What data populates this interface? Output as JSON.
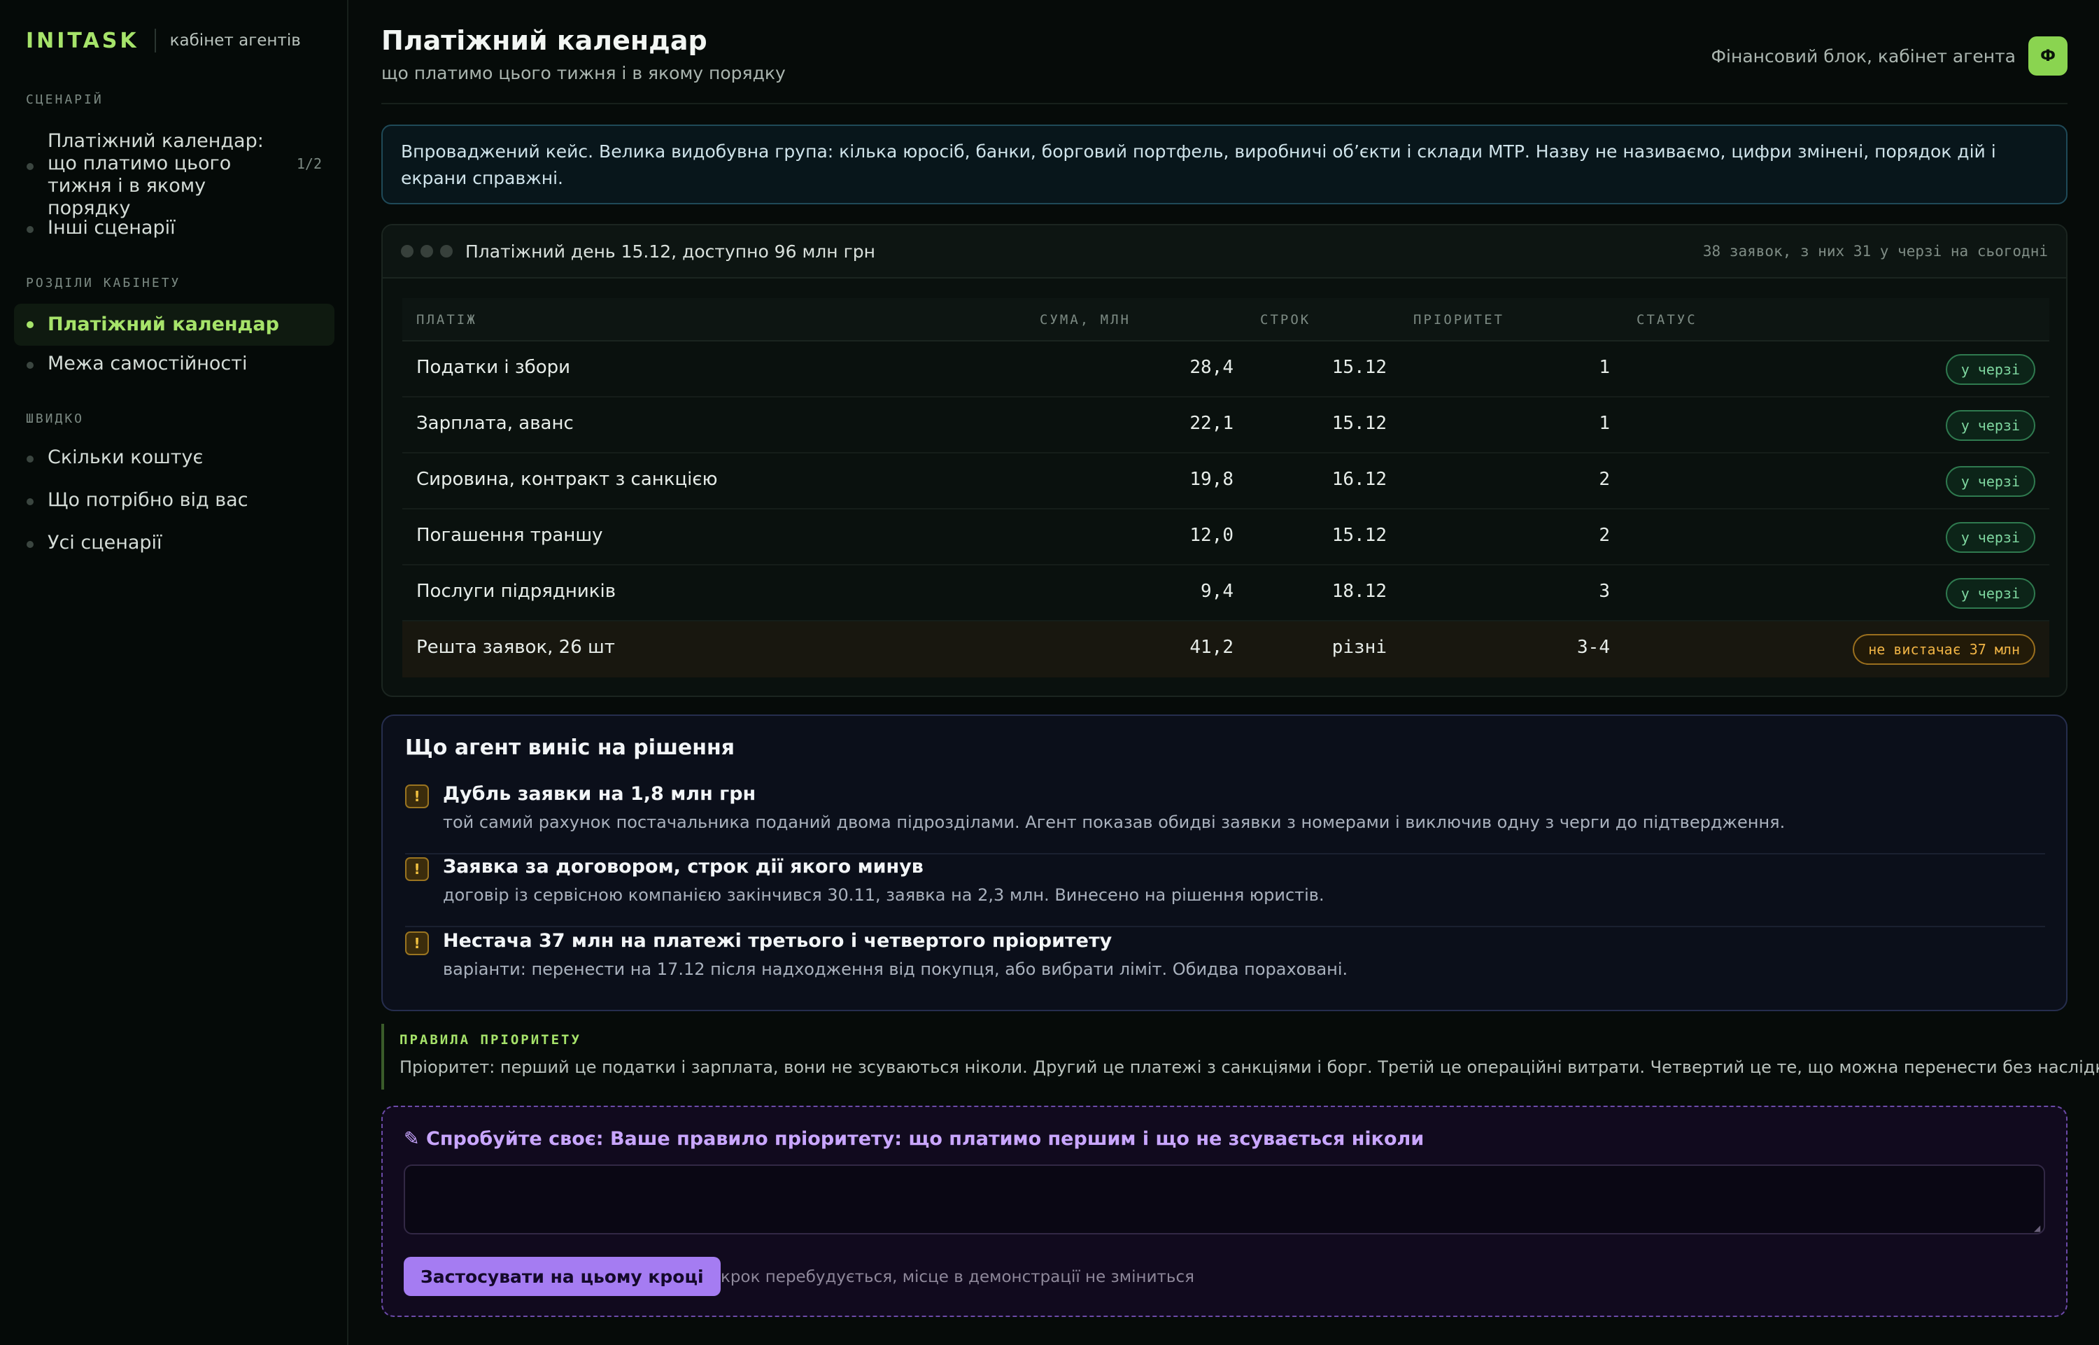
{
  "brand": {
    "logo": "INITASK",
    "subtitle": "кабінет агентів"
  },
  "sidebar": {
    "groups": [
      {
        "title": "СЦЕНАРІЙ",
        "items": [
          {
            "label": "Платіжний календар: що платимо цього тижня і в якому порядку",
            "badge": "1/2"
          },
          {
            "label": "Інші сценарії"
          }
        ]
      },
      {
        "title": "РОЗДІЛИ КАБІНЕТУ",
        "items": [
          {
            "label": "Платіжний календар",
            "active": true
          },
          {
            "label": "Межа самостійності"
          }
        ]
      },
      {
        "title": "ШВИДКО",
        "items": [
          {
            "label": "Скільки коштує"
          },
          {
            "label": "Що потрібно від вас"
          },
          {
            "label": "Усі сценарії"
          }
        ]
      }
    ]
  },
  "header": {
    "title": "Платіжний календар",
    "subtitle": "що платимо цього тижня і в якому порядку",
    "owner": "Фінансовий блок, кабінет агента",
    "avatar": "Ф"
  },
  "intro": "Впроваджений кейс. Велика видобувна група: кілька юросіб, банки, борговий портфель, виробничі об’єкти і склади МТР. Назву не називаємо, цифри змінені, порядок дій і екрани справжні.",
  "panel": {
    "title": "Платіжний день 15.12, доступно 96 млн грн",
    "meta": "38 заявок, з них 31 у черзі на сьогодні",
    "columns": [
      "ПЛАТІЖ",
      "СУМА, МЛН",
      "СТРОК",
      "ПРІОРИТЕТ",
      "СТАТУС"
    ],
    "rows": [
      {
        "name": "Податки і збори",
        "amount": "28,4",
        "due": "15.12",
        "priority": "1",
        "status": "у черзі"
      },
      {
        "name": "Зарплата, аванс",
        "amount": "22,1",
        "due": "15.12",
        "priority": "1",
        "status": "у черзі"
      },
      {
        "name": "Сировина, контракт з санкцією",
        "amount": "19,8",
        "due": "16.12",
        "priority": "2",
        "status": "у черзі"
      },
      {
        "name": "Погашення траншу",
        "amount": "12,0",
        "due": "15.12",
        "priority": "2",
        "status": "у черзі"
      },
      {
        "name": "Послуги підрядників",
        "amount": "9,4",
        "due": "18.12",
        "priority": "3",
        "status": "у черзі"
      },
      {
        "name": "Решта заявок, 26 шт",
        "amount": "41,2",
        "due": "різні",
        "priority": "3-4",
        "status": "не вистачає 37 млн"
      }
    ]
  },
  "decisions": {
    "title": "Що агент виніс на рішення",
    "icon": "!",
    "items": [
      {
        "head": "Дубль заявки на 1,8 млн грн",
        "desc": "той самий рахунок постачальника поданий двома підрозділами. Агент показав обидві заявки з номерами і виключив одну з черги до підтвердження."
      },
      {
        "head": "Заявка за договором, строк дії якого минув",
        "desc": "договір із сервісною компанією закінчився 30.11, заявка на 2,3 млн. Винесено на рішення юристів."
      },
      {
        "head": "Нестача 37 млн на платежі третього і четвертого пріоритету",
        "desc": "варіанти: перенести на 17.12 після надходження від покупця, або вибрати ліміт. Обидва пораховані."
      }
    ]
  },
  "rules": {
    "title": "ПРАВИЛА ПРІОРИТЕТУ",
    "text": "Пріоритет: перший це податки і зарплата, вони не зсуваються ніколи. Другий це платежі з санкціями і борг. Третій це операційні витрати. Четвертий це те, що можна перенести без наслідків."
  },
  "try": {
    "title": "✎ Спробуйте своє: Ваше правило пріоритету: що платимо першим і що не зсувається ніколи",
    "value": "",
    "button": "Застосувати на цьому кроці",
    "note": "крок перебудується, місце в демонстрації не зміниться"
  },
  "colors": {
    "accent": "#a6e36a",
    "ok": "#7fd7a0",
    "warn": "#f0b445",
    "purple": "#a57cf2"
  }
}
